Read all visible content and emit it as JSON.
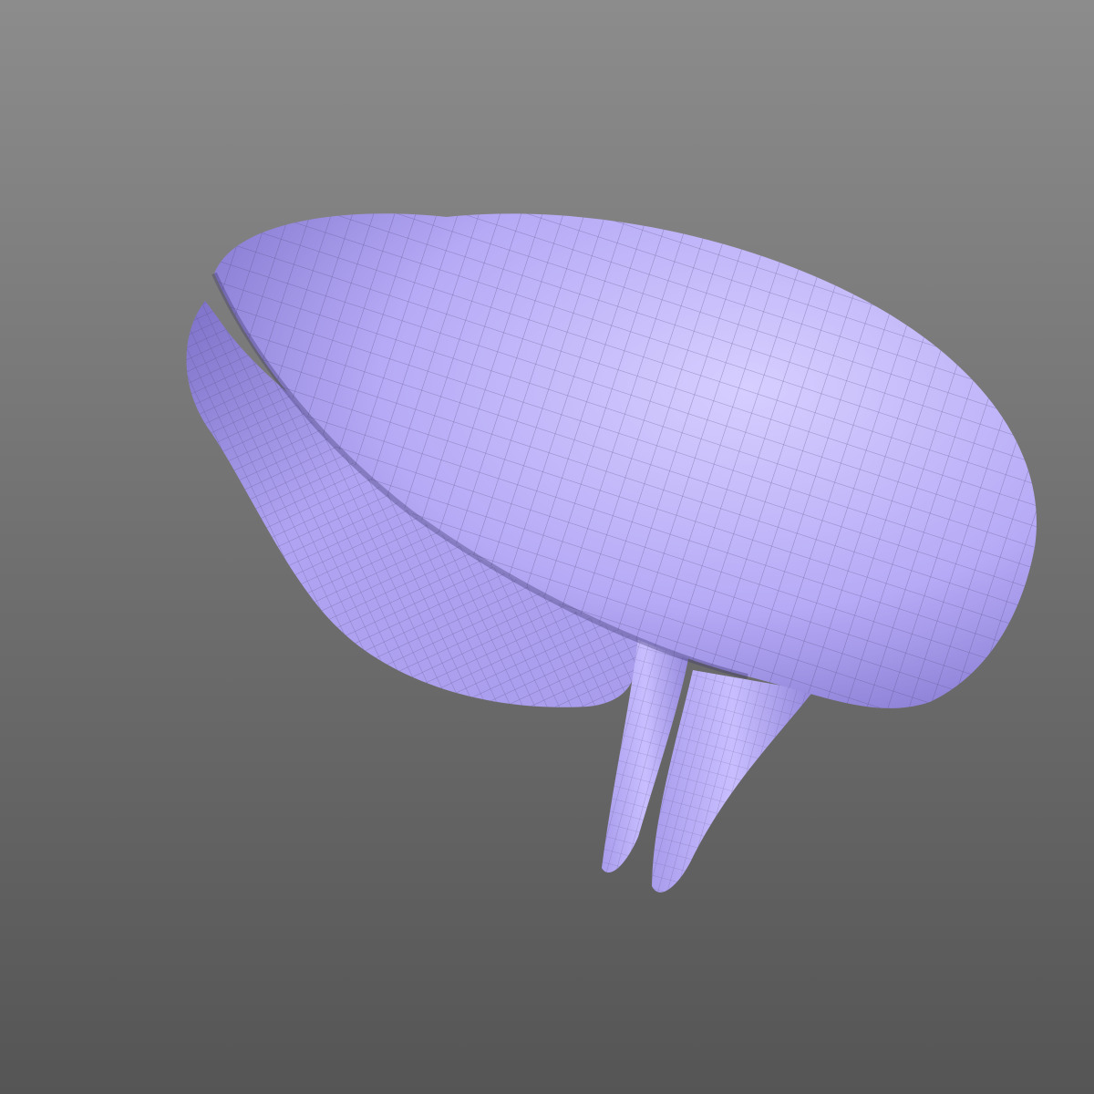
{
  "scene": {
    "object": "mesh-model",
    "colors": {
      "mesh_fill": "#b8acf8",
      "mesh_highlight": "#d4ccff",
      "mesh_shadow": "#6a5fb0",
      "wire": "#4a4470",
      "background_top": "#8c8c8c",
      "background_bottom": "#555555"
    }
  }
}
